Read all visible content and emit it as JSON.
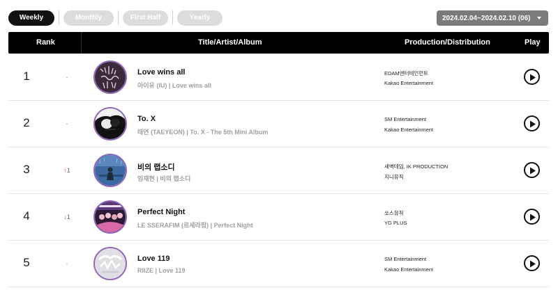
{
  "tabs": [
    {
      "label": "Weekly",
      "active": true
    },
    {
      "label": "Monthly",
      "active": false
    },
    {
      "label": "First Half",
      "active": false
    },
    {
      "label": "Yearly",
      "active": false
    }
  ],
  "date_select": {
    "label": "2024.02.04~2024.02.10 (06)"
  },
  "table_header": {
    "rank": "Rank",
    "title": "Title/Artist/Album",
    "production": "Production/Distribution",
    "play": "Play"
  },
  "rows": [
    {
      "rank": "1",
      "change": "-",
      "change_dir": "none",
      "title": "Love wins all",
      "subtitle": "아이유 (IU) | Love wins all",
      "production": "EDAM엔터테인먼트",
      "distribution": "Kakao Entertainment",
      "cover_icon": "love-wins-all-cover"
    },
    {
      "rank": "2",
      "change": "-",
      "change_dir": "none",
      "title": "To. X",
      "subtitle": "태연 (TAEYEON) | To. X - The 5th Mini Album",
      "production": "SM Entertainment",
      "distribution": "Kakao Entertainment",
      "cover_icon": "to-x-cover"
    },
    {
      "rank": "3",
      "change": "1",
      "change_dir": "up",
      "title": "비의 랩소디",
      "subtitle": "임재현 | 비의 랩소디",
      "production": "새벽테임, IK PRODUCTION",
      "distribution": "지니뮤직",
      "cover_icon": "rain-rhapsody-cover"
    },
    {
      "rank": "4",
      "change": "1",
      "change_dir": "down",
      "title": "Perfect Night",
      "subtitle": "LE SSERAFIM (르세라핌) | Perfect Night",
      "production": "쏘스뮤직",
      "distribution": "YG PLUS",
      "cover_icon": "perfect-night-cover"
    },
    {
      "rank": "5",
      "change": "-",
      "change_dir": "none",
      "title": "Love 119",
      "subtitle": "RIIZE | Love 119",
      "production": "SM Entertainment",
      "distribution": "Kakao Entertainment",
      "cover_icon": "love-119-cover"
    }
  ],
  "colors": {
    "header_bg": "#000000",
    "cover_ring": "#9068b8",
    "up": "#e0463c",
    "down": "#3a9a4a"
  }
}
